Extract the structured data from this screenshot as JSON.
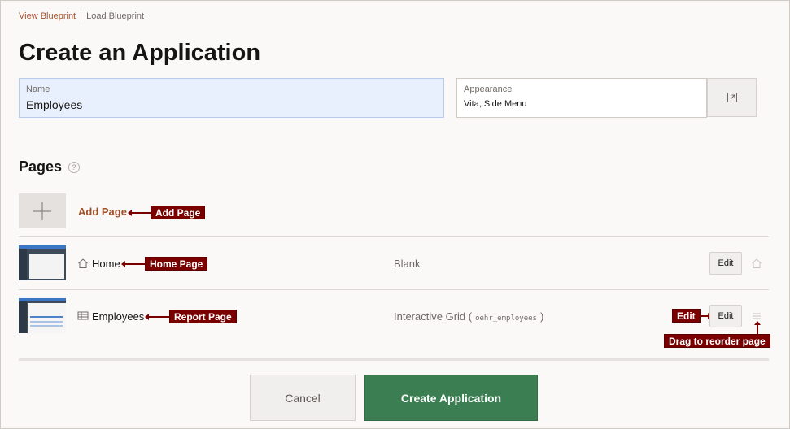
{
  "breadcrumb": {
    "link": "View Blueprint",
    "current": "Load Blueprint"
  },
  "page_title": "Create an Application",
  "name_field": {
    "label": "Name",
    "value": "Employees"
  },
  "appearance_field": {
    "label": "Appearance",
    "value": "Vita, Side Menu"
  },
  "pages_section": {
    "heading": "Pages",
    "help_glyph": "?",
    "add_page_label": "Add Page"
  },
  "rows": [
    {
      "name": "Home",
      "type": "Blank",
      "edit_label": "Edit",
      "icon": "home-icon"
    },
    {
      "name": "Employees",
      "type": "Interactive Grid (",
      "type_table": "oehr_employees",
      "type_close": ")",
      "edit_label": "Edit",
      "icon": "grid-icon"
    }
  ],
  "callouts": {
    "add_page": "Add Page",
    "home_page": "Home Page",
    "report_page": "Report Page",
    "edit": "Edit",
    "drag": "Drag to reorder page"
  },
  "footer": {
    "cancel_label": "Cancel",
    "create_label": "Create Application"
  },
  "colors": {
    "accent_link": "#a3512d",
    "primary_button": "#3a7e52",
    "callout": "#7a0000"
  }
}
